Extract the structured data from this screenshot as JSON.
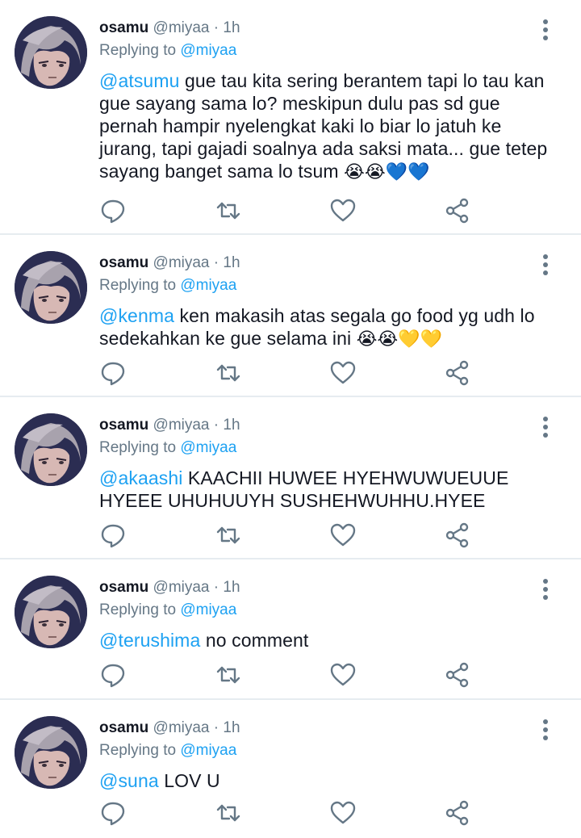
{
  "tweets": [
    {
      "name": "osamu",
      "handle": "@miyaa",
      "dot": "·",
      "time": "1h",
      "reply_prefix": "Replying to",
      "reply_to": "@miyaa",
      "mention": "@atsumu",
      "text": " gue tau kita sering berantem tapi lo tau kan gue sayang sama lo? meskipun dulu pas sd gue pernah hampir nyelengkat kaki lo biar lo jatuh ke jurang, tapi gajadi soalnya ada saksi mata... gue tetep sayang banget sama lo tsum ",
      "emojis": "😭😭💙💙"
    },
    {
      "name": "osamu",
      "handle": "@miyaa",
      "dot": "·",
      "time": "1h",
      "reply_prefix": "Replying to",
      "reply_to": "@miyaa",
      "mention": "@kenma",
      "text": " ken makasih atas segala go food yg udh lo sedekahkan ke gue selama ini ",
      "emojis": "😭😭💛💛"
    },
    {
      "name": "osamu",
      "handle": "@miyaa",
      "dot": "·",
      "time": "1h",
      "reply_prefix": "Replying to",
      "reply_to": "@miyaa",
      "mention": "@akaashi",
      "text": " KAACHII HUWEE HYEHWUWUEUUE HYEEE UHUHUUYH SUSHEHWUHHU.HYEE",
      "emojis": ""
    },
    {
      "name": "osamu",
      "handle": "@miyaa",
      "dot": "·",
      "time": "1h",
      "reply_prefix": "Replying to",
      "reply_to": "@miyaa",
      "mention": "@terushima",
      "text": " no comment",
      "emojis": ""
    },
    {
      "name": "osamu",
      "handle": "@miyaa",
      "dot": "·",
      "time": "1h",
      "reply_prefix": "Replying to",
      "reply_to": "@miyaa",
      "mention": "@suna",
      "text": " LOV U",
      "emojis": ""
    }
  ],
  "icons": {
    "reply": "reply-icon",
    "retweet": "retweet-icon",
    "like": "like-icon",
    "share": "share-icon",
    "more": "more-options-icon",
    "avatar": "avatar"
  },
  "colors": {
    "mention": "#1da1f2",
    "secondary_text": "#657786",
    "icon": "#657786",
    "divider": "#e6ecf0"
  }
}
